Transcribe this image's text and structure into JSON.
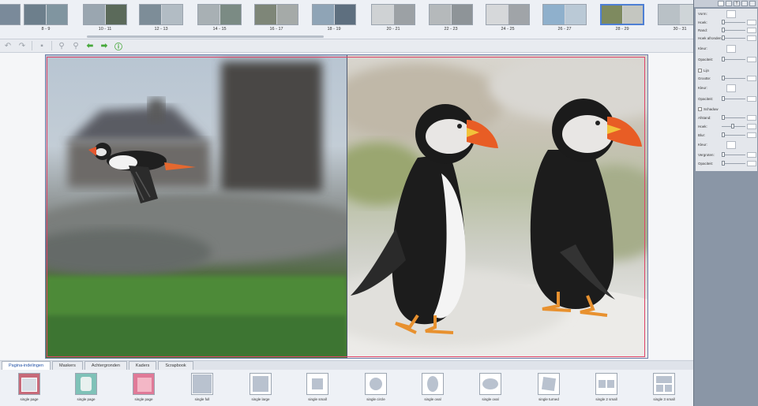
{
  "filmstrip": {
    "spreads": [
      {
        "label": "",
        "left": "#5b7fa8",
        "right": "#7a8a9a"
      },
      {
        "label": "8 - 9",
        "left": "#6d7f8c",
        "right": "#8095a0"
      },
      {
        "label": "10 - 11",
        "left": "#9aa6b0",
        "right": "#5b6a5a"
      },
      {
        "label": "12 - 13",
        "left": "#7d8d98",
        "right": "#b2bcc4"
      },
      {
        "label": "14 - 15",
        "left": "#a8b0b4",
        "right": "#7b8b84"
      },
      {
        "label": "16 - 17",
        "left": "#7e8678",
        "right": "#a5aaa8"
      },
      {
        "label": "18 - 19",
        "left": "#8fa4b6",
        "right": "#5e6f7f"
      },
      {
        "label": "20 - 21",
        "left": "#cfd2d4",
        "right": "#9ca1a5"
      },
      {
        "label": "22 - 23",
        "left": "#b5b9bb",
        "right": "#8e9498"
      },
      {
        "label": "24 - 25",
        "left": "#d6d8da",
        "right": "#a0a4a8"
      },
      {
        "label": "26 - 27",
        "left": "#8fb0cc",
        "right": "#bac9d6"
      },
      {
        "label": "28 - 29",
        "left": "#7e8a5f",
        "right": "#c4c6c0"
      },
      {
        "label": "30 - 31",
        "left": "#b9c1c6",
        "right": "#cfd5d8"
      }
    ],
    "selected_index": 11
  },
  "toolbar": {
    "undo_icon": "↶",
    "redo_icon": "↷",
    "save_icon": "▪",
    "zoom_out_icon": "⚲",
    "zoom_in_icon": "⚲",
    "prev_icon": "⬅",
    "next_icon": "➡",
    "info_icon": "ⓘ"
  },
  "panel": {
    "rows": {
      "kleur_top": "Vorm:",
      "hoekradius": "Hoek:",
      "randbreedte": "Rand:",
      "hoek_afronden": "Hoek afronden:",
      "kleur": "Kleur:",
      "opaciteit": "Opaciteit:",
      "lijn": "Lijn",
      "grootte": "Grootte:",
      "kleur2": "Kleur:",
      "opaciteit2": "Opaciteit:",
      "schaduw": "Schaduw",
      "afstand": "Afstand:",
      "hoek2": "Hoek:",
      "blur": "Blur:",
      "kleur3": "Kleur:",
      "vergroten": "Vergroten:",
      "opaciteit3": "Opaciteit:"
    }
  },
  "tabs": [
    {
      "label": "Pagina-indelingen",
      "active": true
    },
    {
      "label": "Maskers",
      "active": false
    },
    {
      "label": "Achtergronden",
      "active": false
    },
    {
      "label": "Kaders",
      "active": false
    },
    {
      "label": "Scrapbook",
      "active": false
    }
  ],
  "templates": [
    {
      "label": "single page",
      "kind": "photo-red"
    },
    {
      "label": "single page",
      "kind": "photo-teal"
    },
    {
      "label": "single page",
      "kind": "photo-pink"
    },
    {
      "label": "single full",
      "kind": "full"
    },
    {
      "label": "single large",
      "kind": "large"
    },
    {
      "label": "single small",
      "kind": "small"
    },
    {
      "label": "single circle",
      "kind": "circle"
    },
    {
      "label": "single oval",
      "kind": "oval-v"
    },
    {
      "label": "single oval",
      "kind": "oval-h"
    },
    {
      "label": "single turned",
      "kind": "turned"
    },
    {
      "label": "single 2 small",
      "kind": "two"
    },
    {
      "label": "single 3 small",
      "kind": "three"
    }
  ],
  "colors": {
    "accent": "#4e7fd4",
    "margin_guide": "#e0446a",
    "panel_bg": "#8a96a6"
  }
}
